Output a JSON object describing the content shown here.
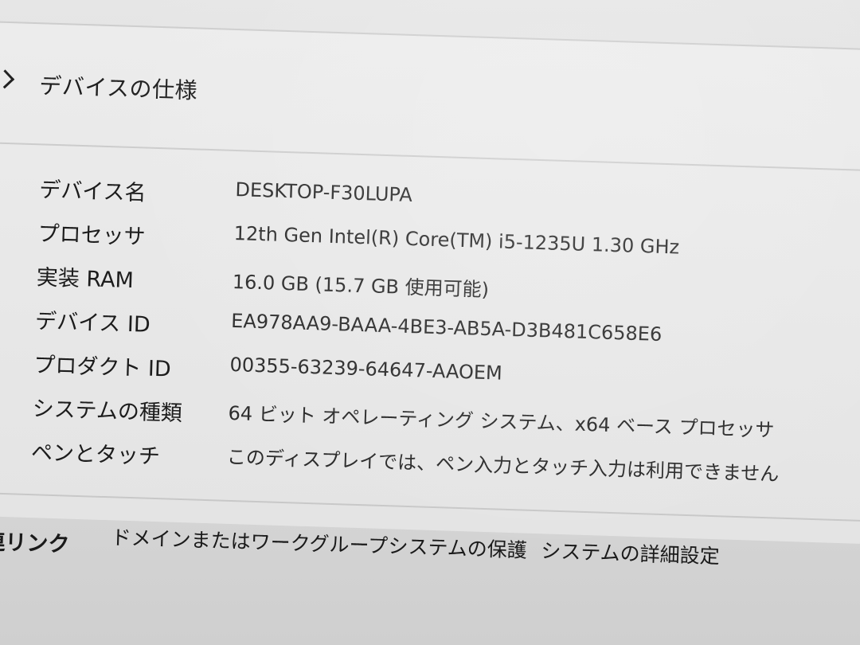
{
  "section": {
    "title": "デバイスの仕様"
  },
  "specs": [
    {
      "label": "デバイス名",
      "value": "DESKTOP-F30LUPA"
    },
    {
      "label": "プロセッサ",
      "value": "12th Gen Intel(R) Core(TM) i5-1235U   1.30 GHz"
    },
    {
      "label": "実装 RAM",
      "value": "16.0 GB (15.7 GB 使用可能)"
    },
    {
      "label": "デバイス ID",
      "value": "EA978AA9-BAAA-4BE3-AB5A-D3B481C658E6"
    },
    {
      "label": "プロダクト ID",
      "value": "00355-63239-64647-AAOEM"
    },
    {
      "label": "システムの種類",
      "value": "64 ビット オペレーティング システム、x64 ベース プロセッサ"
    },
    {
      "label": "ペンとタッチ",
      "value": "このディスプレイでは、ペン入力とタッチ入力は利用できません"
    }
  ],
  "related": {
    "label": "連リンク",
    "links": [
      "ドメインまたはワークグループ",
      "システムの保護",
      "システムの詳細設定"
    ]
  },
  "icons": {
    "collapse": "chevron-up-icon"
  }
}
